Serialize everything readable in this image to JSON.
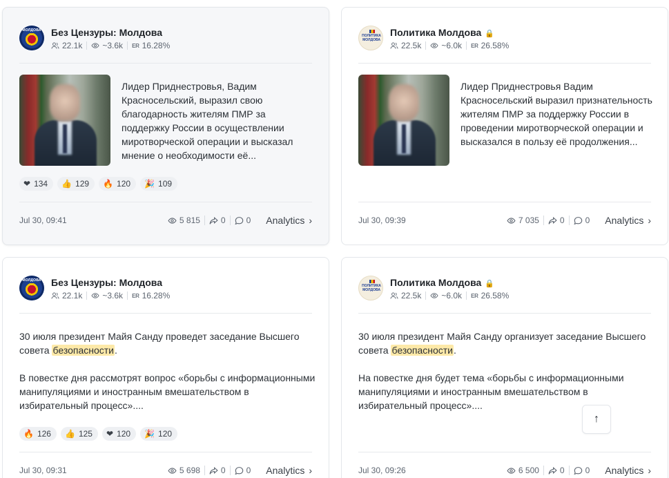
{
  "posts": [
    {
      "channel": "Без Цензуры: Молдова",
      "avatar_text": "МОЛДОВА",
      "locked": false,
      "subscribers": "22.1k",
      "views_avg": "~3.6k",
      "er_label": "ER",
      "er": "16.28%",
      "text": "Лидер Приднестровья, Вадим Красносельский, выразил свою благодарность жителям ПМР за поддержку России в осуществлении миротворческой операции и высказал мнение о необходимости её...",
      "reactions": [
        {
          "emoji": "❤",
          "count": "134"
        },
        {
          "emoji": "👍",
          "count": "129"
        },
        {
          "emoji": "🔥",
          "count": "120"
        },
        {
          "emoji": "🎉",
          "count": "109"
        }
      ],
      "date": "Jul 30, 09:41",
      "views": "5 815",
      "shares": "0",
      "comments": "0",
      "analytics_label": "Analytics"
    },
    {
      "channel": "Политика Молдова",
      "avatar_text": "ПОЛИТИКА МОЛДОВА",
      "locked": true,
      "lock_icon": "🔒",
      "subscribers": "22.5k",
      "views_avg": "~6.0k",
      "er_label": "ER",
      "er": "26.58%",
      "text": "Лидер Приднестровья Вадим Красносельский выразил признательность жителям ПМР за поддержку России в проведении миротворческой операции и высказался в пользу её продолжения...",
      "reactions": [],
      "date": "Jul 30, 09:39",
      "views": "7 035",
      "shares": "0",
      "comments": "0",
      "analytics_label": "Analytics"
    },
    {
      "channel": "Без Цензуры: Молдова",
      "avatar_text": "МОЛДОВА",
      "locked": false,
      "subscribers": "22.1k",
      "views_avg": "~3.6k",
      "er_label": "ER",
      "er": "16.28%",
      "text_p1_pre": "30 июля президент Майя Санду проведет заседание Высшего совета ",
      "text_p1_hl": "безопасности",
      "text_p1_post": ".",
      "text_p2": "В повестке дня рассмотрят вопрос «борьбы с информационными манипуляциями и иностранным вмешательством в избирательный процесс»....",
      "reactions": [
        {
          "emoji": "🔥",
          "count": "126"
        },
        {
          "emoji": "👍",
          "count": "125"
        },
        {
          "emoji": "❤",
          "count": "120"
        },
        {
          "emoji": "🎉",
          "count": "120"
        }
      ],
      "date": "Jul 30, 09:31",
      "views": "5 698",
      "shares": "0",
      "comments": "0",
      "analytics_label": "Analytics"
    },
    {
      "channel": "Политика Молдова",
      "avatar_text": "ПОЛИТИКА МОЛДОВА",
      "locked": true,
      "lock_icon": "🔒",
      "subscribers": "22.5k",
      "views_avg": "~6.0k",
      "er_label": "ER",
      "er": "26.58%",
      "text_p1_pre": "30 июля президент Майя Санду организует заседание Высшего совета ",
      "text_p1_hl": "безопасности",
      "text_p1_post": ".",
      "text_p2": "На повестке дня будет тема «борьбы с информационными манипуляциями и иностранным вмешательством в избирательный процесс»....",
      "reactions": [],
      "date": "Jul 30, 09:26",
      "views": "6 500",
      "shares": "0",
      "comments": "0",
      "analytics_label": "Analytics"
    }
  ],
  "scroll_top_icon": "↑"
}
